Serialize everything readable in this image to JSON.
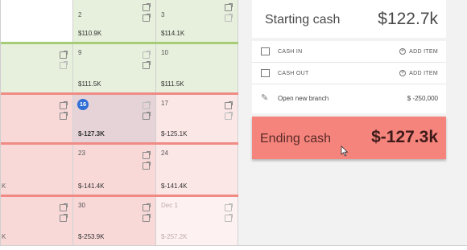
{
  "calendar": {
    "rows": [
      {
        "cells": [
          {
            "day": "",
            "amount": ""
          },
          {
            "day": "2",
            "amount": "$110.9K"
          },
          {
            "day": "3",
            "amount": "$114.1K"
          }
        ]
      },
      {
        "cells": [
          {
            "day": "",
            "amount": ""
          },
          {
            "day": "9",
            "amount": "$111.5K"
          },
          {
            "day": "10",
            "amount": "$111.5K"
          }
        ]
      },
      {
        "cells": [
          {
            "day": "",
            "amount": ""
          },
          {
            "day": "16",
            "amount": "$-127.3K"
          },
          {
            "day": "17",
            "amount": "$-125.1K"
          }
        ]
      },
      {
        "cells": [
          {
            "day": "",
            "amount": ""
          },
          {
            "day": "23",
            "amount": "$-141.4K"
          },
          {
            "day": "24",
            "amount": "$-141.4K"
          }
        ]
      },
      {
        "cells": [
          {
            "day": "",
            "amount": ""
          },
          {
            "day": "30",
            "amount": "$-253.9K"
          },
          {
            "day": "Dec 1",
            "amount": "$-257.2K"
          }
        ]
      }
    ],
    "stub_letter": "K"
  },
  "panel": {
    "starting_label": "Starting cash",
    "starting_value": "$122.7k",
    "cash_in_label": "CASH IN",
    "cash_out_label": "CASH OUT",
    "add_item_label": "ADD ITEM",
    "branch_label": "Open new branch",
    "branch_amount": "$ -250,000",
    "ending_label": "Ending cash",
    "ending_value": "$-127.3k"
  },
  "colors": {
    "positive_bg": "#e6f0dc",
    "negative_bg": "#f8d9d8",
    "ending_bg": "#f4847c",
    "today_badge": "#2f6fd6"
  }
}
